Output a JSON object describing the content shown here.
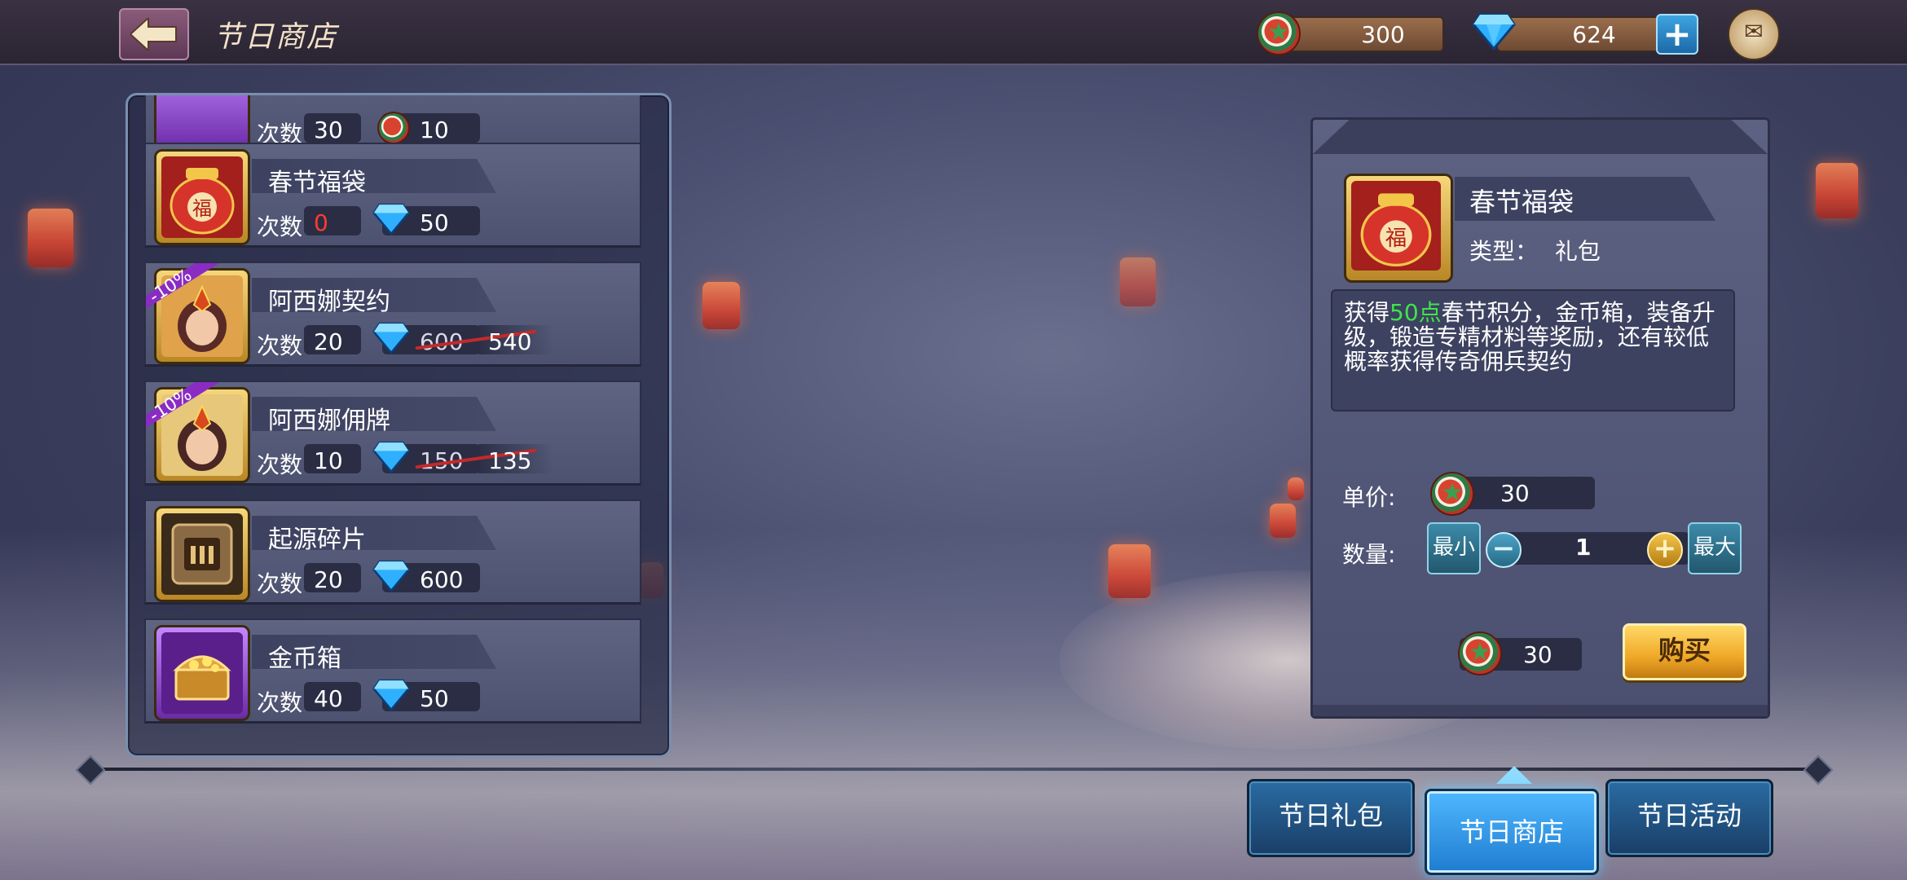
{
  "header": {
    "title": "节日商店",
    "festival_points": "300",
    "gems": "624"
  },
  "icons": {
    "back": "back-arrow-icon",
    "token": "festival-token-icon",
    "gem": "blue-gem-icon",
    "add": "plus-icon",
    "mail": "mail-icon"
  },
  "shop_list": {
    "count_label": "次数",
    "partial_top_item": {
      "count": "30",
      "price": "10"
    },
    "items": [
      {
        "name": "春节福袋",
        "count": "0",
        "price": "50",
        "discount": "",
        "old_price": "",
        "icon": "lucky-bag-icon"
      },
      {
        "name": "阿西娜契约",
        "count": "20",
        "price": "540",
        "discount": "-10%",
        "old_price": "600",
        "icon": "athena-contract-portrait-icon"
      },
      {
        "name": "阿西娜佣牌",
        "count": "10",
        "price": "135",
        "discount": "-10%",
        "old_price": "150",
        "icon": "athena-card-portrait-icon"
      },
      {
        "name": "起源碎片",
        "count": "20",
        "price": "600",
        "discount": "",
        "old_price": "",
        "icon": "origin-fragment-icon"
      },
      {
        "name": "金币箱",
        "count": "40",
        "price": "50",
        "discount": "",
        "old_price": "",
        "icon": "gold-chest-icon"
      }
    ]
  },
  "detail": {
    "name": "春节福袋",
    "type_label": "类型：",
    "type_value": "礼包",
    "desc_prefix": "获得",
    "desc_highlight": "50点",
    "desc_rest": "春节积分，金币箱，装备升级，锻造专精材料等奖励，还有较低概率获得传奇佣兵契约",
    "unit_price_label": "单价:",
    "unit_price": "30",
    "quantity_label": "数量:",
    "min_label": "最小",
    "max_label": "最大",
    "quantity": "1",
    "total": "30",
    "buy_label": "购买"
  },
  "tabs": [
    {
      "label": "节日礼包",
      "active": false
    },
    {
      "label": "节日商店",
      "active": true
    },
    {
      "label": "节日活动",
      "active": false
    }
  ],
  "colors": {
    "highlight_green": "#3ee54a",
    "count_zero_red": "#ff3b2e",
    "active_tab": "#4fb8ff",
    "buy_button": "#f0a828"
  }
}
